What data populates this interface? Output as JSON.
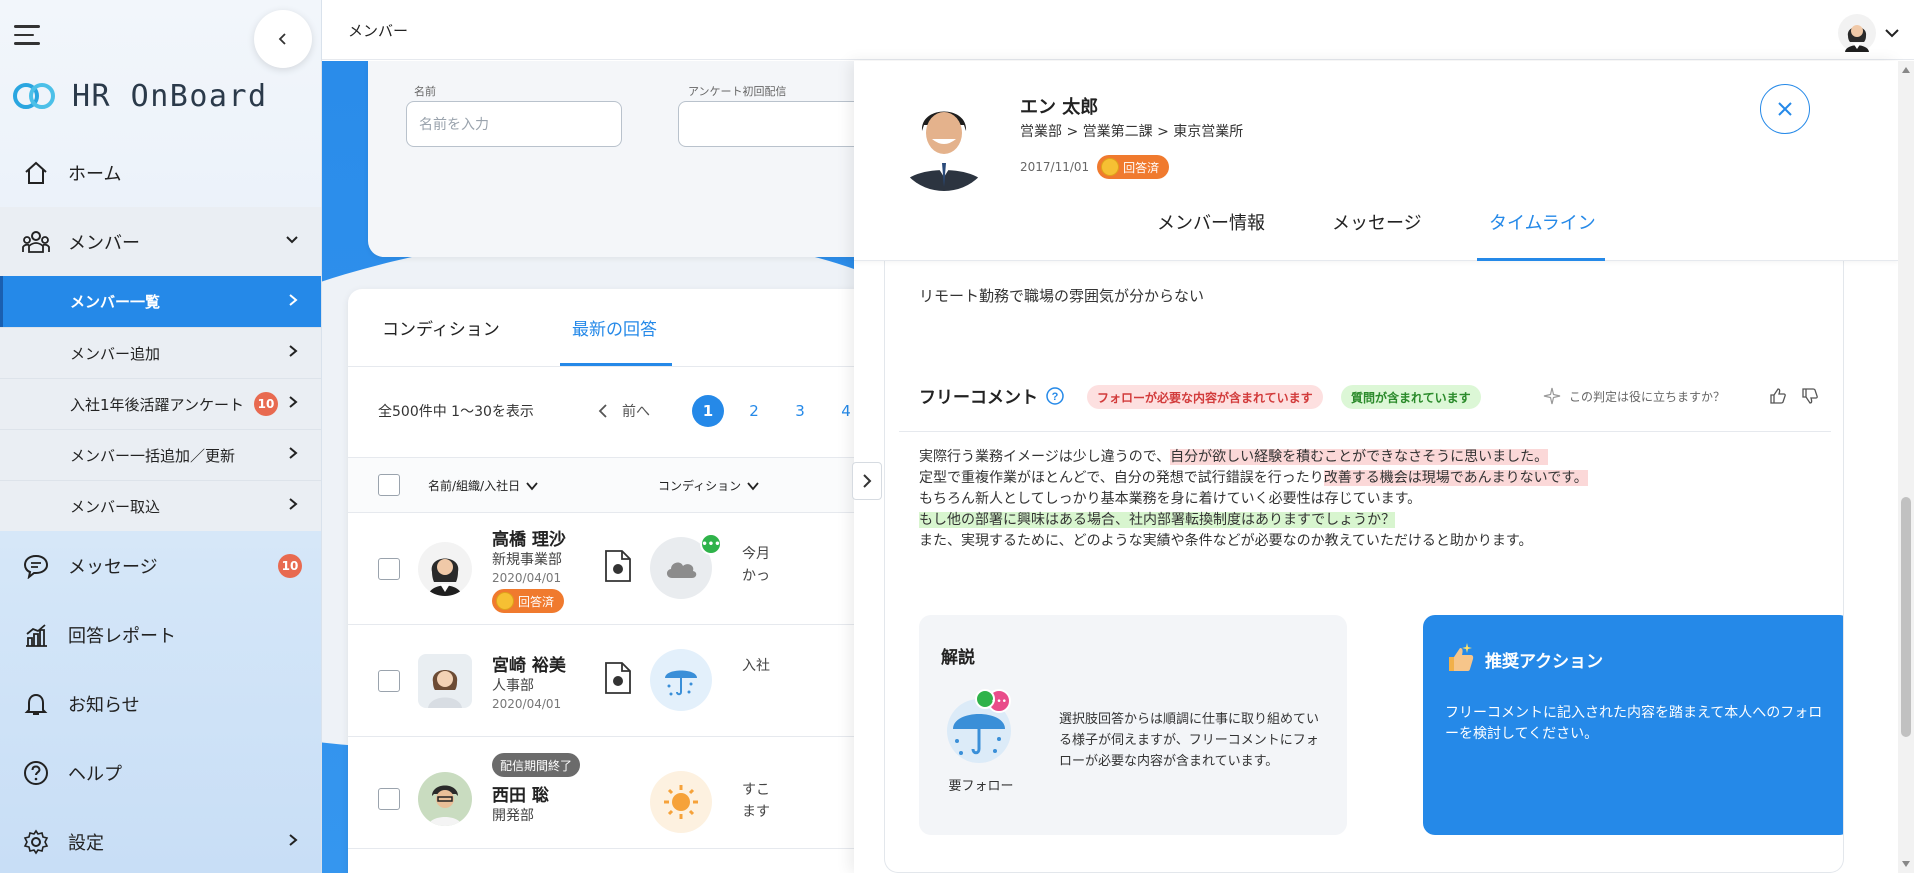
{
  "sidebar": {
    "app_name": "HR OnBoard",
    "nav": [
      {
        "label": "ホーム",
        "icon": "home-icon"
      },
      {
        "label": "メンバー",
        "icon": "members-icon"
      },
      {
        "label": "メッセージ",
        "icon": "message-icon",
        "badge": "10"
      },
      {
        "label": "回答レポート",
        "icon": "report-icon"
      },
      {
        "label": "お知らせ",
        "icon": "bell-icon"
      },
      {
        "label": "ヘルプ",
        "icon": "help-icon"
      },
      {
        "label": "設定",
        "icon": "settings-icon"
      }
    ],
    "member_sub": [
      {
        "label": "メンバー一覧",
        "active": true
      },
      {
        "label": "メンバー追加"
      },
      {
        "label": "入社1年後活躍アンケート",
        "badge": "10"
      },
      {
        "label": "メンバー一括追加／更新"
      },
      {
        "label": "メンバー取込"
      }
    ]
  },
  "topbar": {
    "title": "メンバー"
  },
  "filter": {
    "name_label": "名前",
    "name_placeholder": "名前を入力",
    "survey_label": "アンケート初回配信"
  },
  "list": {
    "tabs": [
      "コンディション",
      "最新の回答"
    ],
    "active_tab": "最新の回答",
    "count_text": "全500件中 1〜30を表示",
    "prev": "前へ",
    "pages": [
      "1",
      "2",
      "3",
      "4"
    ],
    "col_name": "名前/組織/入社日",
    "col_condition": "コンディション",
    "rows": [
      {
        "name": "高橋 理沙",
        "dept": "新規事業部",
        "date": "2020/04/01",
        "status": "回答済",
        "snippet1": "今月",
        "snippet2": "かっ"
      },
      {
        "name": "宮崎 裕美",
        "dept": "人事部",
        "date": "2020/04/01",
        "snippet1": "入社"
      },
      {
        "name": "西田 聡",
        "dept": "開発部",
        "tag": "配信期間終了",
        "snippet1": "すこ",
        "snippet2": "ます"
      }
    ]
  },
  "panel": {
    "name": "エン 太郎",
    "org": "営業部 > 営業第二課 > 東京営業所",
    "date": "2017/11/01",
    "status": "回答済",
    "tabs": [
      "メンバー情報",
      "メッセージ",
      "タイムライン"
    ],
    "active_tab": "タイムライン",
    "remote_text": "リモート勤務で職場の雰囲気が分からない",
    "free_comment_label": "フリーコメント",
    "tag_follow": "フォローが必要な内容が含まれています",
    "tag_question": "質問が含まれています",
    "helpful_q": "この判定は役に立ちますか？",
    "comment": {
      "l1a": "実際行う業務イメージは少し違うので、",
      "l1b": "自分が欲しい経験を積むことができなさそうに思いました。",
      "l2a": "定型で重複作業がほとんどで、自分の発想で試行錯誤を行ったり",
      "l2b": "改善する機会は現場であんまりないです。",
      "l3": "もちろん新人としてしっかり基本業務を身に着けていく必要性は存じています。",
      "l4": "もし他の部署に興味はある場合、社内部署転換制度はありますでしょうか？",
      "l5": "また、実現するために、どのような実績や条件などが必要なのか教えていただけると助かります。"
    },
    "explanation": {
      "title": "解説",
      "icon_label": "要フォロー",
      "text": "選択肢回答からは順調に仕事に取り組めている様子が伺えますが、フリーコメントにフォローが必要な内容が含まれています。"
    },
    "action": {
      "title": "推奨アクション",
      "text": "フリーコメントに記入された内容を踏まえて本人へのフォローを検討してください。"
    }
  },
  "colors": {
    "accent": "#2589e8",
    "badge": "#e86a50",
    "answered": "#f07a2e"
  }
}
